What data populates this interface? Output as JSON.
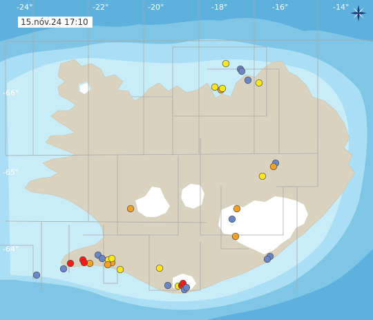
{
  "timestamp": "15.nóv.24  17:10",
  "longitude_labels": [
    "-24°",
    "-22°",
    "-20°",
    "-18°",
    "-16°",
    "-14°"
  ],
  "latitude_labels": [
    "-66°",
    "-65°",
    "-64°"
  ],
  "colors": {
    "deep_sea": "#5fb1dd",
    "mid_sea": "#8fd0ee",
    "shallow_sea": "#c9ecf9",
    "land": "#d9d2bf",
    "glacier": "#ffffff",
    "grid": "#a8a8a8",
    "quake_red": "#ff1a1a",
    "quake_orange": "#f5a020",
    "quake_yellow": "#ffe61a",
    "quake_blue": "#6a86c6"
  },
  "compass_icon": "compass-rose-icon",
  "earthquakes": [
    {
      "age": "yellow",
      "region": "north-offshore"
    },
    {
      "age": "blue",
      "region": "north-offshore"
    },
    {
      "age": "blue",
      "region": "north-offshore"
    },
    {
      "age": "blue",
      "region": "north-offshore"
    },
    {
      "age": "yellow",
      "region": "north-offshore"
    },
    {
      "age": "yellow",
      "region": "north-coast"
    },
    {
      "age": "orange",
      "region": "north-coast"
    },
    {
      "age": "yellow",
      "region": "north-coast"
    },
    {
      "age": "blue",
      "region": "northeast-inland"
    },
    {
      "age": "orange",
      "region": "northeast-inland"
    },
    {
      "age": "yellow",
      "region": "northeast-inland"
    },
    {
      "age": "orange",
      "region": "central-west"
    },
    {
      "age": "orange",
      "region": "vatnajokull"
    },
    {
      "age": "blue",
      "region": "vatnajokull"
    },
    {
      "age": "orange",
      "region": "vatnajokull"
    },
    {
      "age": "blue",
      "region": "southeast"
    },
    {
      "age": "blue",
      "region": "southeast"
    },
    {
      "age": "blue",
      "region": "reykjanes-offshore"
    },
    {
      "age": "blue",
      "region": "reykjanes"
    },
    {
      "age": "red",
      "region": "reykjanes"
    },
    {
      "age": "red",
      "region": "reykjanes"
    },
    {
      "age": "orange",
      "region": "reykjanes"
    },
    {
      "age": "red",
      "region": "reykjanes"
    },
    {
      "age": "orange",
      "region": "reykjanes"
    },
    {
      "age": "blue",
      "region": "south-lowland"
    },
    {
      "age": "blue",
      "region": "south-lowland"
    },
    {
      "age": "yellow",
      "region": "south-lowland"
    },
    {
      "age": "yellow",
      "region": "south-lowland"
    },
    {
      "age": "orange",
      "region": "south-lowland"
    },
    {
      "age": "yellow",
      "region": "south-lowland"
    },
    {
      "age": "yellow",
      "region": "myrdalsjokull"
    },
    {
      "age": "blue",
      "region": "myrdalsjokull"
    },
    {
      "age": "yellow",
      "region": "myrdalsjokull"
    },
    {
      "age": "red",
      "region": "myrdalsjokull"
    },
    {
      "age": "red",
      "region": "myrdalsjokull"
    },
    {
      "age": "blue",
      "region": "myrdalsjokull"
    },
    {
      "age": "blue",
      "region": "myrdalsjokull"
    }
  ]
}
